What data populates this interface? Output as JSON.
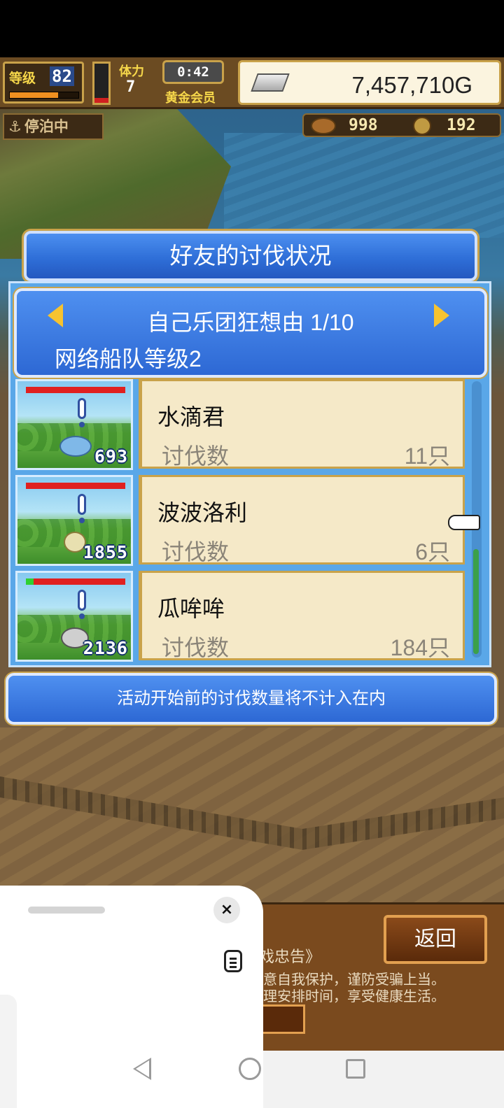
{
  "hud": {
    "level_label": "等级",
    "level": "82",
    "exp_fraction": 0.7,
    "stamina_fraction": 0.12,
    "stamina_label": "体力",
    "stamina_value": "7",
    "timer": "0:42",
    "member_label": "黄金会员",
    "gold": "7,457,710G"
  },
  "status": {
    "anchor_label": "停泊中",
    "resource1": "998",
    "resource2": "192"
  },
  "dialog": {
    "title": "好友的讨伐状况",
    "team_name": "自己乐团狂想由 1/10",
    "fleet_level": "网络船队等级2",
    "notice": "活动开始前的讨伐数量将不计入在内",
    "rows": [
      {
        "name": "水滴君",
        "kill_label": "讨伐数",
        "kill_count": "11只",
        "power": "693",
        "hp_fraction": 0.0
      },
      {
        "name": "波波洛利",
        "kill_label": "讨伐数",
        "kill_count": "6只",
        "power": "1855",
        "hp_fraction": 0.0
      },
      {
        "name": "瓜哞哞",
        "kill_label": "讨伐数",
        "kill_count": "184只",
        "power": "2136",
        "hp_fraction": 0.08
      }
    ]
  },
  "bottom": {
    "back_label": "返回",
    "health_title": "戏忠告》",
    "health_line1": "意自我保护，谨防受骗上当。",
    "health_line2": "理安排时间，享受健康生活。"
  },
  "sheet": {
    "close_label": "×"
  },
  "colors": {
    "panel_blue": "#2d68d4",
    "card_bg": "#f5e9c8",
    "gold_border": "#c9a24a",
    "hp_red": "#e02020",
    "hp_green": "#30d030"
  }
}
